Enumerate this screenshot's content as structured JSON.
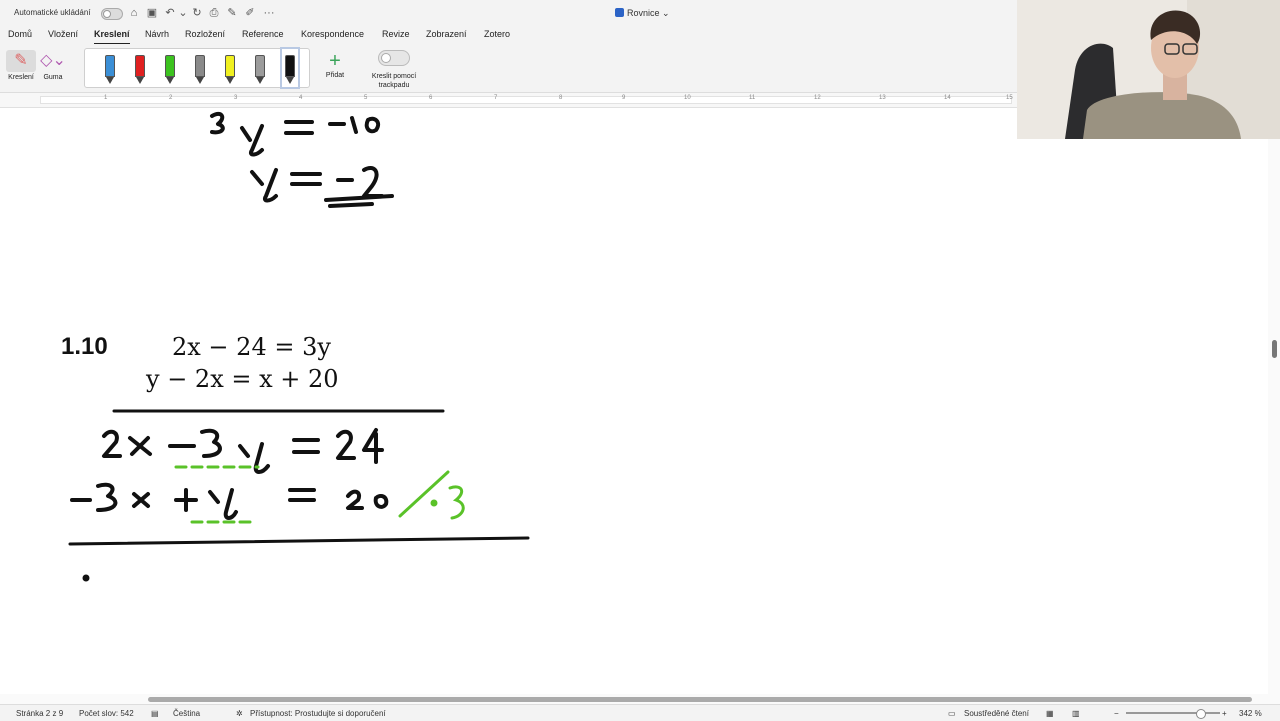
{
  "titlebar": {
    "autosave_label": "Automatické ukládání",
    "document_title": "Rovnice",
    "more": "···"
  },
  "tabs": [
    "Domů",
    "Vložení",
    "Kreslení",
    "Návrh",
    "Rozložení",
    "Reference",
    "Korespondence",
    "Revize",
    "Zobrazení",
    "Zotero"
  ],
  "active_tab": "Kreslení",
  "ribbon": {
    "draw_label": "Kreslení",
    "eraser_label": "Guma",
    "add_label": "Přidat",
    "trackpad_label_line1": "Kreslit pomocí",
    "trackpad_label_line2": "trackpadu",
    "pens": [
      {
        "color": "#3b8fd6",
        "name": "blue-pen"
      },
      {
        "color": "#e02020",
        "name": "red-pen"
      },
      {
        "color": "#3cc31f",
        "name": "green-pen"
      },
      {
        "color": "#8a8a8a",
        "name": "gray-pencil"
      },
      {
        "color": "#f0f020",
        "name": "yellow-highlighter"
      },
      {
        "color": "#9c9c9c",
        "name": "gray-pen"
      },
      {
        "color": "#111111",
        "name": "black-pen"
      }
    ]
  },
  "ruler": {
    "numbers": [
      "1",
      "2",
      "3",
      "4",
      "5",
      "6",
      "7",
      "8",
      "9",
      "10",
      "11",
      "12",
      "13",
      "14",
      "15"
    ]
  },
  "document": {
    "exercise_label": "1.10",
    "equation1": "2x − 24 = 3y",
    "equation2": "y − 2x = x + 20"
  },
  "ink_colors": {
    "black": "#111111",
    "green": "#5ac229"
  },
  "status": {
    "page": "Stránka 2 z 9",
    "words": "Počet slov: 542",
    "language": "Čeština",
    "accessibility": "Přístupnost: Prostudujte si doporučení",
    "focus": "Soustředěné čtení",
    "zoom": "342 %"
  }
}
